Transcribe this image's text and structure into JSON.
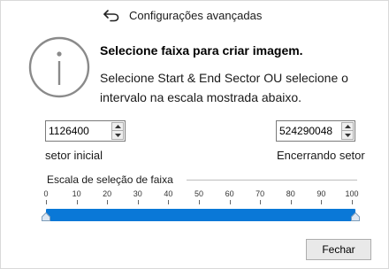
{
  "window": {
    "title": "Configurações avançadas",
    "back_icon": "back-arrow-icon"
  },
  "info": {
    "icon": "info-icon",
    "heading": "Selecione faixa para criar imagem.",
    "description": "Selecione Start & End Sector OU selecione o intervalo na escala mostrada abaixo."
  },
  "start_sector": {
    "value": "1126400",
    "label": "setor inicial"
  },
  "end_sector": {
    "value": "524290048",
    "label": "Encerrando setor"
  },
  "scale": {
    "title": "Escala de seleção de faixa",
    "ticks": [
      "0",
      "10",
      "20",
      "30",
      "40",
      "50",
      "60",
      "70",
      "80",
      "90",
      "100"
    ],
    "selection_start": 0,
    "selection_end": 100,
    "accent_color": "#0a78d7"
  },
  "footer": {
    "close_label": "Fechar"
  }
}
